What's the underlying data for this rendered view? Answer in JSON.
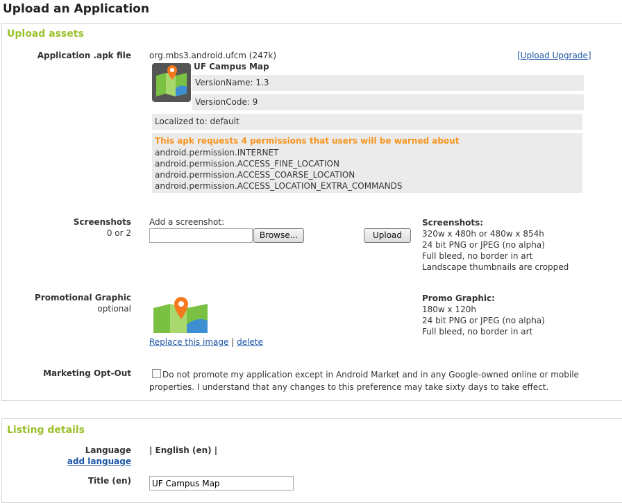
{
  "page": {
    "title": "Upload an Application"
  },
  "assets": {
    "section_title": "Upload assets",
    "apk": {
      "label": "Application .apk file",
      "filename": "org.mbs3.android.ufcm (247k)",
      "upload_upgrade": "[Upload Upgrade]",
      "app_name": "UF Campus Map",
      "version_name": "VersionName: 1.3",
      "version_code": "VersionCode: 9",
      "localized": "Localized to: default",
      "permissions_warning": "This apk requests 4 permissions that users will be warned about",
      "permissions": [
        "android.permission.INTERNET",
        "android.permission.ACCESS_FINE_LOCATION",
        "android.permission.ACCESS_COARSE_LOCATION",
        "android.permission.ACCESS_LOCATION_EXTRA_COMMANDS"
      ]
    },
    "screenshots": {
      "label": "Screenshots",
      "count": "0 or 2",
      "add_label": "Add a screenshot:",
      "file_value": "",
      "browse_label": "Browse...",
      "upload_label": "Upload",
      "info_title": "Screenshots:",
      "info": [
        "320w x 480h or 480w x 854h",
        "24 bit PNG or JPEG (no alpha)",
        "Full bleed, no border in art",
        "Landscape thumbnails are cropped"
      ]
    },
    "promo": {
      "label": "Promotional Graphic",
      "optional": "optional",
      "replace_link": "Replace this image",
      "separator": "|",
      "delete_link": "delete",
      "info_title": "Promo Graphic:",
      "info": [
        "180w x 120h",
        "24 bit PNG or JPEG (no alpha)",
        "Full bleed, no border in art"
      ]
    },
    "marketing": {
      "label": "Marketing Opt-Out",
      "checked": false,
      "text_line1": "Do not promote my application except in Android Market and in any Google-owned online or mobile",
      "text_line2": "properties. I understand that any changes to this preference may take sixty days to take effect."
    }
  },
  "listing": {
    "section_title": "Listing details",
    "language_label": "Language",
    "add_language": "add language",
    "language_value": "| English (en) |",
    "title_label": "Title (en)",
    "title_value": "UF Campus Map"
  },
  "colors": {
    "section_title": "#9ac12c",
    "warning": "#f7941d",
    "link": "#1a55a6",
    "box_bg": "#ebebeb"
  },
  "icons": [
    "app-map-icon",
    "promo-map-graphic",
    "checkbox"
  ]
}
